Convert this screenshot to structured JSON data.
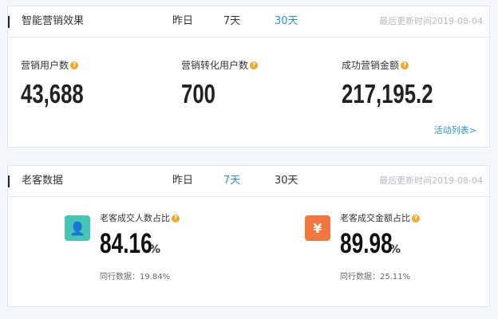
{
  "marketing": {
    "title": "智能营销效果",
    "tabs": [
      {
        "label": "昨日"
      },
      {
        "label": "7天"
      },
      {
        "label": "30天"
      }
    ],
    "active_tab": "30天",
    "updated": "最后更新时间2019-08-04",
    "metrics": [
      {
        "label": "营销用户数",
        "value": "43,688"
      },
      {
        "label": "营销转化用户数",
        "value": "700"
      },
      {
        "label": "成功营销金额",
        "value": "217,195.2"
      }
    ],
    "activity_link": "活动列表>"
  },
  "customers": {
    "title": "老客数据",
    "tabs": [
      {
        "label": "昨日"
      },
      {
        "label": "7天"
      },
      {
        "label": "30天"
      }
    ],
    "active_tab": "7天",
    "updated": "最后更新时间2019-08-04",
    "stats": [
      {
        "label": "老客成交人数占比",
        "value": "84.16",
        "unit": "%",
        "peer": "同行数据：19.84%",
        "icon": "user-icon",
        "icon_glyph": "👤",
        "icon_color": "#45c4b8"
      },
      {
        "label": "老客成交金额占比",
        "value": "89.98",
        "unit": "%",
        "peer": "同行数据：25.11%",
        "icon": "yen-icon",
        "icon_glyph": "¥",
        "icon_color": "#f1763f"
      }
    ]
  },
  "colors": {
    "accent": "#2f8fd8",
    "help_icon": "#f5a623"
  },
  "help_icon_glyph": "?"
}
